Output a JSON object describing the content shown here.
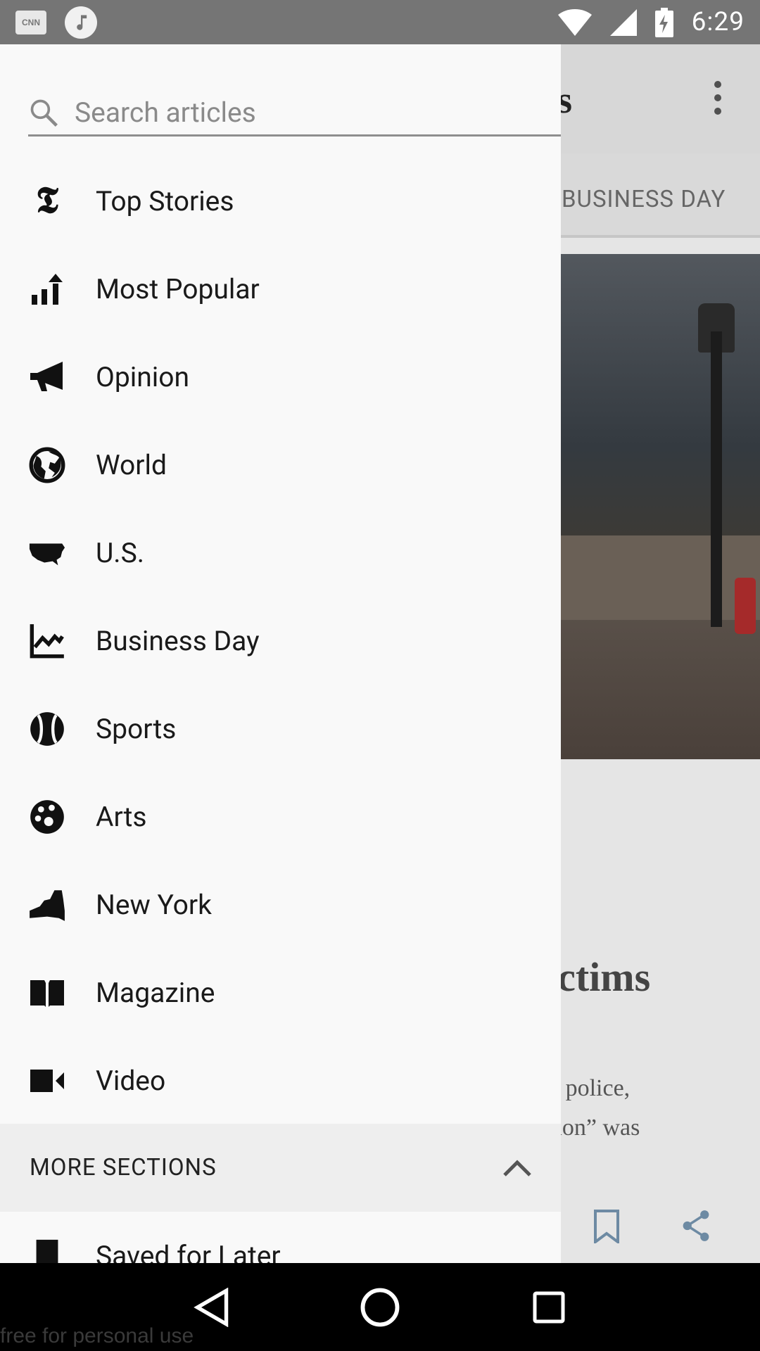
{
  "status_bar": {
    "time": "6:29",
    "notification_icons": [
      "cnn-icon",
      "music-icon"
    ],
    "system_icons": [
      "wifi-icon",
      "signal-icon",
      "battery-charging-icon"
    ]
  },
  "background_app": {
    "title_fragment": "s",
    "tab_fragment": "BUSINESS DAY",
    "headline_fragment": "ictims",
    "summary_lines": [
      "e police,",
      "tion” was"
    ]
  },
  "drawer": {
    "search": {
      "placeholder": "Search articles",
      "value": ""
    },
    "items": [
      {
        "label": "Top Stories",
        "icon": "nyt-logo-icon"
      },
      {
        "label": "Most Popular",
        "icon": "trending-icon"
      },
      {
        "label": "Opinion",
        "icon": "megaphone-icon"
      },
      {
        "label": "World",
        "icon": "globe-icon"
      },
      {
        "label": "U.S.",
        "icon": "us-map-icon"
      },
      {
        "label": "Business Day",
        "icon": "chart-icon"
      },
      {
        "label": "Sports",
        "icon": "baseball-icon"
      },
      {
        "label": "Arts",
        "icon": "palette-icon"
      },
      {
        "label": "New York",
        "icon": "new-york-map-icon"
      },
      {
        "label": "Magazine",
        "icon": "book-icon"
      },
      {
        "label": "Video",
        "icon": "video-camera-icon"
      }
    ],
    "more_sections_label": "MORE SECTIONS",
    "saved_label": "Saved for Later"
  },
  "watermark": "free for personal use",
  "colors": {
    "status_bar": "#757575",
    "drawer_bg": "#f9f9f9",
    "more_sections_bg": "#eeeeee",
    "nav_bar": "#000000"
  }
}
